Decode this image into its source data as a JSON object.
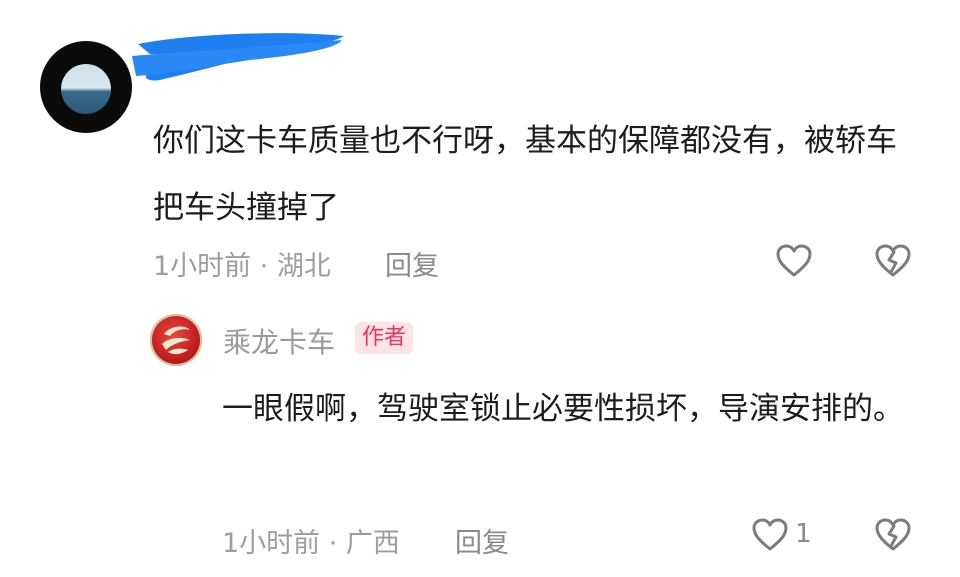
{
  "comment": {
    "text": "你们这卡车质量也不行呀，基本的保障都没有，被轿车把车头撞掉了",
    "time_location": "1小时前 · 湖北",
    "reply_label": "回复",
    "like_count": ""
  },
  "reply": {
    "author_name": "乘龙卡车",
    "author_badge": "作者",
    "text": "一眼假啊，驾驶室锁止必要性损坏，导演安排的。",
    "time_location": "1小时前 · 广西",
    "reply_label": "回复",
    "like_count": "1"
  },
  "colors": {
    "badge_text": "#f0345a",
    "badge_bg": "#fde3e7",
    "redaction": "#1f7ff0"
  },
  "icons": [
    "heart-outline-icon",
    "broken-heart-icon"
  ]
}
